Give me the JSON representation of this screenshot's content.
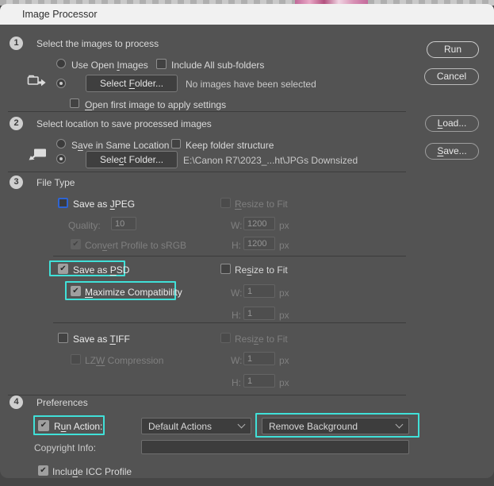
{
  "window": {
    "title": "Image Processor"
  },
  "icons": {
    "check": "✔"
  },
  "colors": {
    "highlight": "#40E0D8",
    "focus_blue": "#2E64D2",
    "dialog_bg": "#535353"
  },
  "buttons": {
    "run": {
      "pre": "Run",
      "u": "",
      "post": ""
    },
    "cancel": {
      "pre": "Cancel",
      "u": "",
      "post": ""
    },
    "load": {
      "pre": "",
      "u": "L",
      "post": "oad..."
    },
    "save": {
      "pre": "",
      "u": "S",
      "post": "ave..."
    }
  },
  "section1": {
    "num": "1",
    "title": "Select the images to process",
    "use_open_images": {
      "pre": "Use Open ",
      "u": "I",
      "post": "mages"
    },
    "include_subfolders": {
      "pre": "Include All sub-folders",
      "u": "",
      "post": ""
    },
    "select_folder": {
      "pre": "Select ",
      "u": "F",
      "post": "older..."
    },
    "status": "No images have been selected",
    "open_first": {
      "pre": "",
      "u": "O",
      "post": "pen first image to apply settings"
    }
  },
  "section2": {
    "num": "2",
    "title": "Select location to save processed images",
    "save_in_same": {
      "pre": "S",
      "u": "a",
      "post": "ve in Same Location"
    },
    "keep_structure": {
      "pre": "Keep folder structure",
      "u": "",
      "post": ""
    },
    "select_folder": {
      "pre": "Sele",
      "u": "c",
      "post": "t Folder..."
    },
    "path": "E:\\Canon R7\\2023_...ht\\JPGs Downsized"
  },
  "section3": {
    "num": "3",
    "title": "File Type",
    "jpeg": {
      "label": {
        "pre": "Save as ",
        "u": "J",
        "post": "PEG"
      },
      "resize": {
        "pre": "",
        "u": "R",
        "post": "esize to Fit"
      },
      "quality_label": "Quality:",
      "quality": "10",
      "convert": {
        "pre": "Con",
        "u": "v",
        "post": "ert Profile to sRGB"
      },
      "w_label": "W:",
      "w": "1200",
      "h_label": "H:",
      "h": "1200",
      "unit": "px"
    },
    "psd": {
      "label": {
        "pre": "Save as ",
        "u": "P",
        "post": "SD"
      },
      "resize": {
        "pre": "Re",
        "u": "s",
        "post": "ize to Fit"
      },
      "maximize": {
        "pre": "",
        "u": "M",
        "post": "aximize Compatibility"
      },
      "w_label": "W:",
      "w": "1",
      "h_label": "H:",
      "h": "1",
      "unit": "px"
    },
    "tiff": {
      "label": {
        "pre": "Save as ",
        "u": "T",
        "post": "IFF"
      },
      "resize": {
        "pre": "Resi",
        "u": "z",
        "post": "e to Fit"
      },
      "lzw": {
        "pre": "LZ",
        "u": "W",
        "post": " Compression"
      },
      "w_label": "W:",
      "w": "1",
      "h_label": "H:",
      "h": "1",
      "unit": "px"
    }
  },
  "section4": {
    "num": "4",
    "title": "Preferences",
    "run_action": {
      "pre": "R",
      "u": "u",
      "post": "n Action:"
    },
    "action_set": "Default Actions",
    "action": "Remove Background",
    "copyright_label": "Copyright Info:",
    "copyright_value": "",
    "icc": {
      "pre": "Inclu",
      "u": "d",
      "post": "e ICC Profile"
    }
  }
}
